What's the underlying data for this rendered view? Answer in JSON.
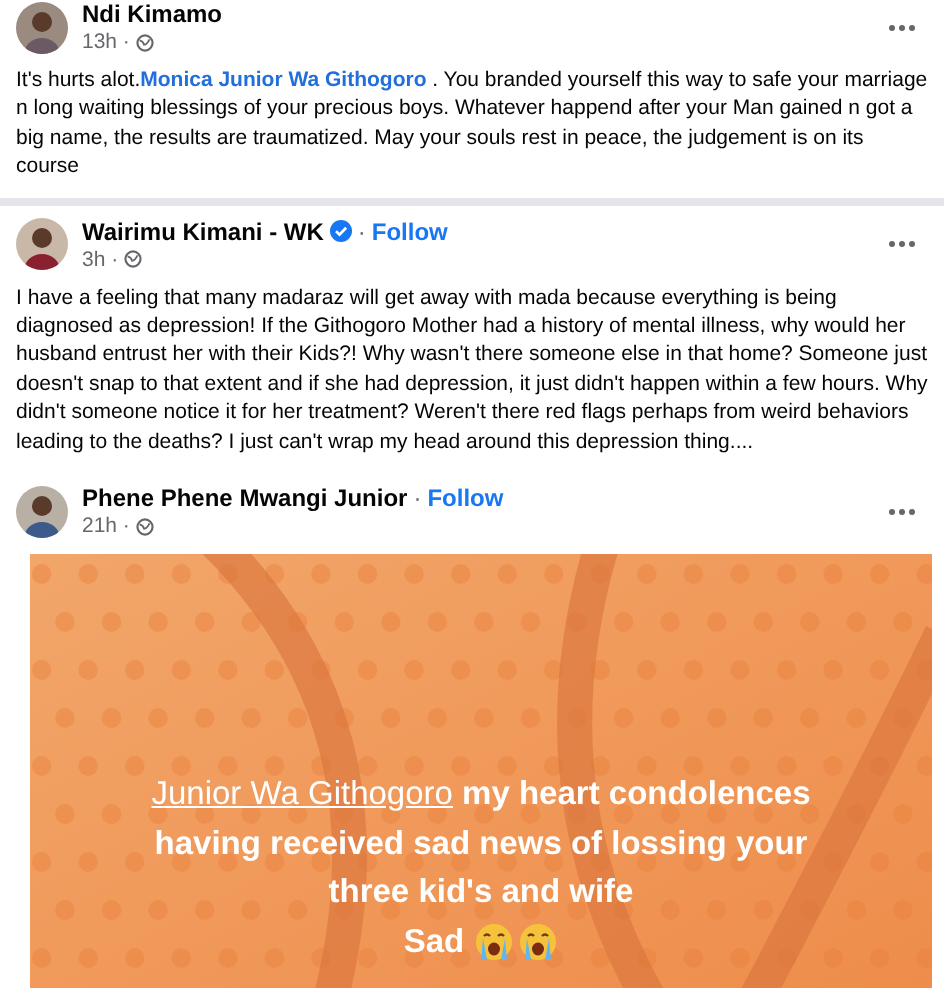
{
  "posts": [
    {
      "author": "Ndi Kimamo",
      "verified": false,
      "time": "13h ·",
      "text_before": "It's hurts alot.",
      "mention": "Monica Junior Wa Githogoro",
      "text_after": " . You branded yourself this way to safe your marriage n long  waiting blessings of your precious boys. Whatever happend after your Man gained n got a big name, the results are traumatized. May your souls rest in peace, the judgement is on its course"
    },
    {
      "author": "Wairimu Kimani - WK",
      "verified": true,
      "separator": "·",
      "follow": "Follow",
      "time": "3h ·",
      "text_before": "I have a feeling that many madaraz will get away with mada because everything is being diagnosed as depression! If the Githogoro Mother had a history of mental illness, why would her husband entrust her with their Kids?! Why wasn't there someone else in that home? Someone just doesn't snap to that extent and if she had depression,  it just didn't happen within a few hours. Why didn't someone notice it for her treatment? Weren't there red flags perhaps from weird behaviors leading to the deaths? I just can't wrap my head around this depression thing...."
    },
    {
      "author": "Phene Phene Mwangi Junior",
      "verified": false,
      "separator": "·",
      "follow": "Follow",
      "time": "21h ·",
      "kind": "text_card",
      "card": {
        "mention": "Junior Wa Githogoro",
        "lines": [
          " my heart condolences",
          "having received sad news of lossing your",
          "three kid's and wife"
        ],
        "closing": "Sad"
      }
    }
  ]
}
